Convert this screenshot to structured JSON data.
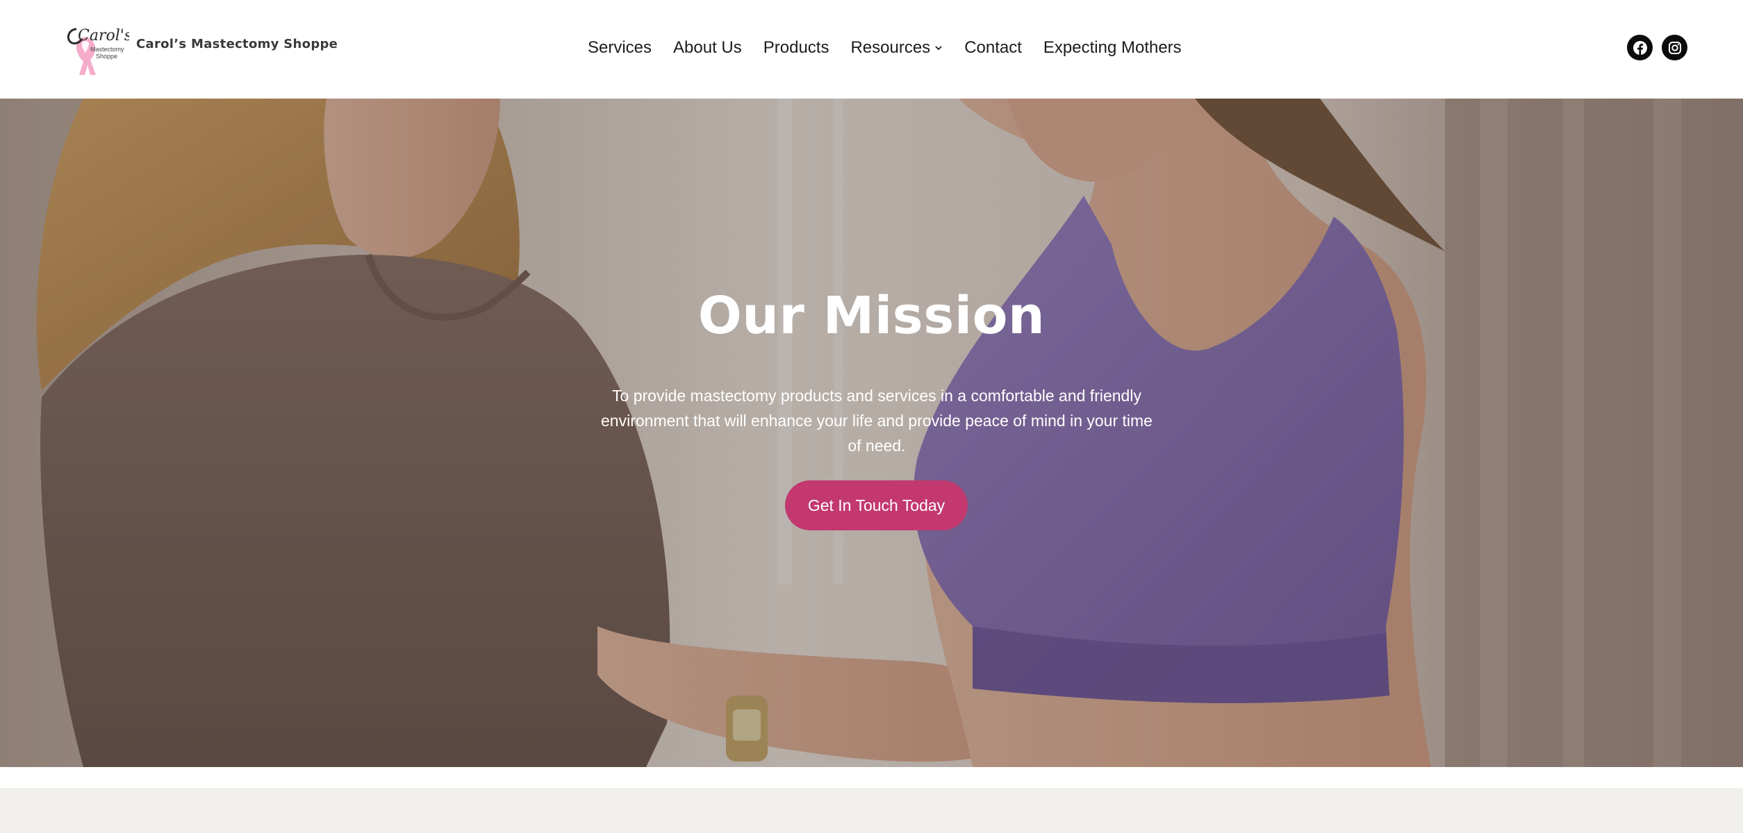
{
  "header": {
    "logo": {
      "script_text": "Carol's",
      "sub_text_line1": "Mastectomy",
      "sub_text_line2": "Shoppe",
      "icon": "pink-ribbon-icon"
    },
    "brand_name": "Carol’s Mastectomy Shoppe",
    "nav": [
      {
        "label": "Services"
      },
      {
        "label": "About Us"
      },
      {
        "label": "Products"
      },
      {
        "label": "Resources",
        "has_dropdown": true,
        "icon": "chevron-down-icon"
      },
      {
        "label": "Contact"
      },
      {
        "label": "Expecting Mothers"
      }
    ],
    "social": [
      {
        "name": "facebook",
        "icon": "facebook-icon"
      },
      {
        "name": "instagram",
        "icon": "instagram-icon"
      }
    ]
  },
  "hero": {
    "title": "Our Mission",
    "text": "To provide mastectomy products and services in a comfortable and friendly environment that will enhance your life and provide peace of mind in your time of need.",
    "cta_label": "Get In Touch Today"
  },
  "colors": {
    "accent": "#c2386f",
    "header_bg": "#ffffff",
    "nav_text": "#1c1c1c",
    "social_bg": "#0b0b0b",
    "next_section_bg": "#f0efeb"
  }
}
